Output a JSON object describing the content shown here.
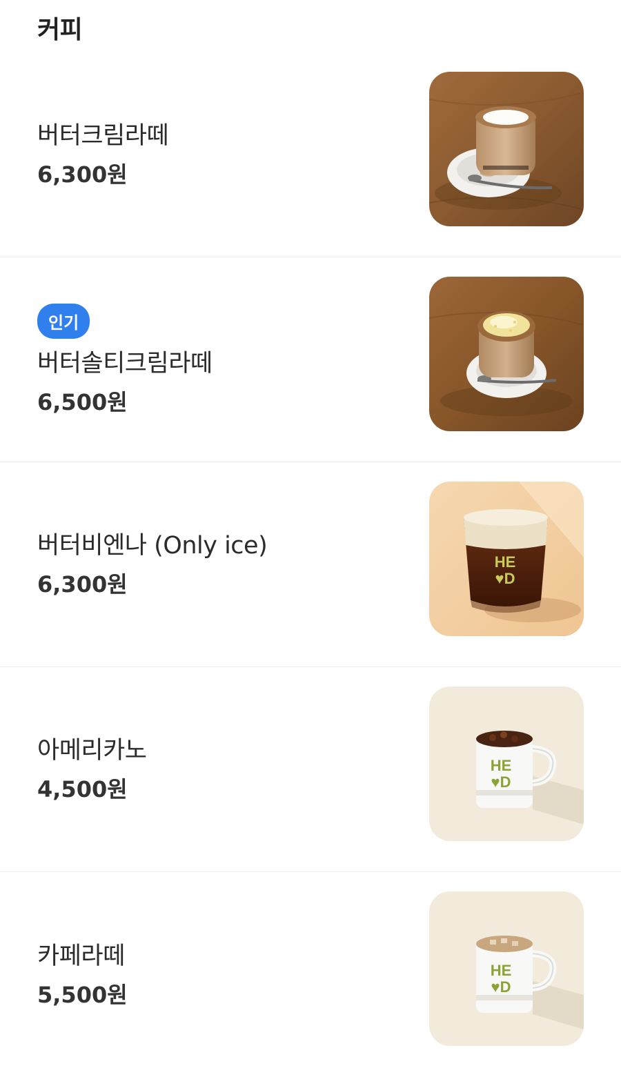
{
  "section": {
    "title": "커피"
  },
  "items": [
    {
      "name": "버터크림라떼",
      "price": "6,300원",
      "badge": "",
      "image": "butter-cream-latte-photo"
    },
    {
      "name": "버터솔티크림라떼",
      "price": "6,500원",
      "badge": "인기",
      "image": "butter-salty-cream-latte-photo"
    },
    {
      "name": "버터비엔나 (Only ice)",
      "price": "6,300원",
      "badge": "",
      "image": "butter-vienna-photo"
    },
    {
      "name": "아메리카노",
      "price": "4,500원",
      "badge": "",
      "image": "americano-photo"
    },
    {
      "name": "카페라떼",
      "price": "5,500원",
      "badge": "",
      "image": "cafe-latte-photo"
    }
  ],
  "cup_logo": {
    "line1": "HE",
    "line2": "♥D"
  },
  "colors": {
    "badge": "#2f80ed",
    "wood": "#8a5a33",
    "cream_bg": "#f1e9d8",
    "logo": "#8aa337"
  }
}
